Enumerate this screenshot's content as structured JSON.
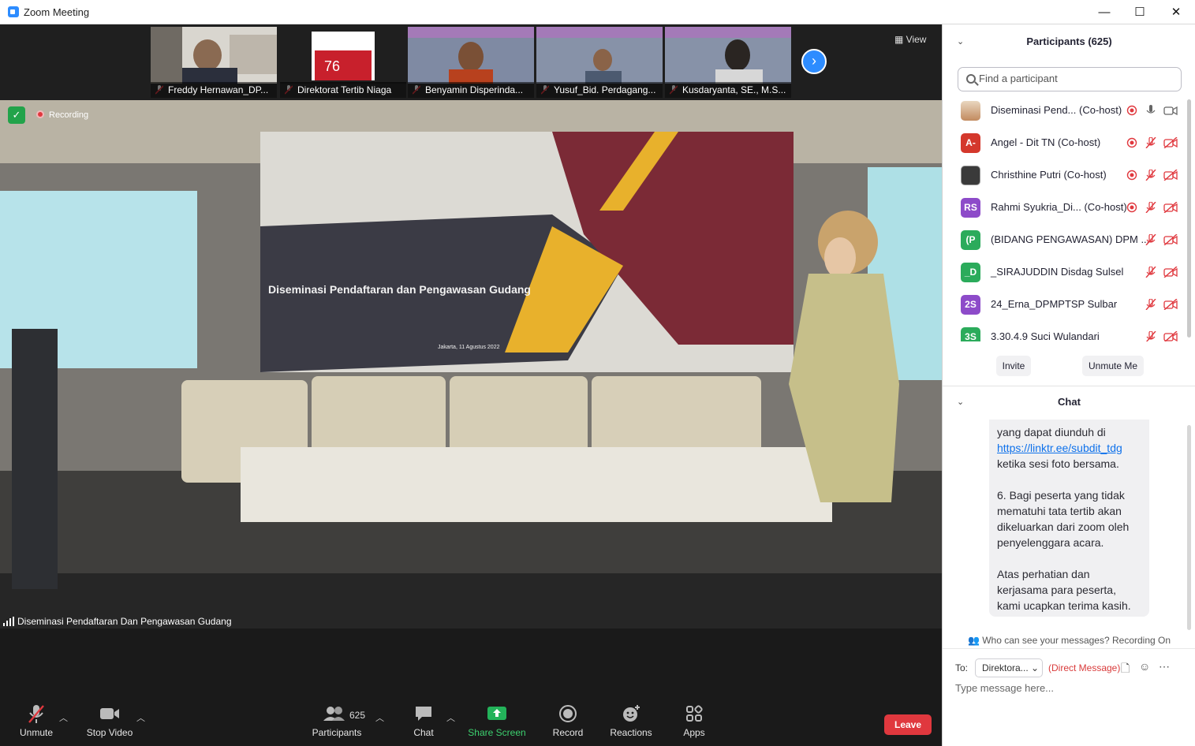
{
  "window": {
    "title": "Zoom Meeting",
    "minimize": "—",
    "maximize": "☐",
    "close": "✕"
  },
  "thumbnails": [
    {
      "name": "Freddy Hernawan_DP..."
    },
    {
      "name": "Direktorat Tertib Niaga"
    },
    {
      "name": "Benyamin Disperinda..."
    },
    {
      "name": "Yusuf_Bid. Perdagang..."
    },
    {
      "name": "Kusdaryanta, SE., M.S..."
    }
  ],
  "view_label": "View",
  "recording_label": "Recording",
  "active_speaker": "Diseminasi Pendaftaran Dan Pengawasan Gudang",
  "toolbar": {
    "unmute": "Unmute",
    "stop_video": "Stop Video",
    "participants": "Participants",
    "participants_count": "625",
    "chat": "Chat",
    "share_screen": "Share Screen",
    "record": "Record",
    "reactions": "Reactions",
    "apps": "Apps",
    "leave": "Leave"
  },
  "participants_panel": {
    "title": "Participants (625)",
    "search_placeholder": "Find a participant",
    "participants": [
      {
        "name": "Diseminasi Pend... (Co-host)",
        "initials": "",
        "color": "#b8926a",
        "mic": "on",
        "video": "on"
      },
      {
        "name": "Angel - Dit TN (Co-host)",
        "initials": "A-",
        "color": "#d4382c",
        "mic": "muted",
        "video": "off"
      },
      {
        "name": "Christhine Putri (Co-host)",
        "initials": "",
        "color": "#3a3a3a",
        "mic": "muted",
        "video": "off"
      },
      {
        "name": "Rahmi Syukria_Di... (Co-host)",
        "initials": "RS",
        "color": "#8d4bc9",
        "mic": "muted",
        "video": "off"
      },
      {
        "name": "(BIDANG PENGAWASAN) DPM ...",
        "initials": "(P",
        "color": "#2bab5b",
        "mic": "muted",
        "video": "off"
      },
      {
        "name": "_SIRAJUDDIN Disdag Sulsel",
        "initials": "_D",
        "color": "#2bab5b",
        "mic": "muted",
        "video": "off"
      },
      {
        "name": "24_Erna_DPMPTSP Sulbar",
        "initials": "2S",
        "color": "#8d4bc9",
        "mic": "muted",
        "video": "off"
      },
      {
        "name": "3.30.4.9 Suci Wulandari",
        "initials": "3S",
        "color": "#2bab5b",
        "mic": "muted",
        "video": "off"
      }
    ],
    "invite": "Invite",
    "unmute_me": "Unmute Me"
  },
  "chat_panel": {
    "title": "Chat",
    "message_lines": [
      "yang dapat diunduh di",
      "ketika sesi foto bersama.",
      "",
      "6. Bagi peserta yang tidak",
      "mematuhi tata tertib akan",
      "dikeluarkan dari zoom oleh",
      "penyelenggara acara.",
      "",
      "Atas perhatian dan",
      "kerjasama para peserta,",
      "kami ucapkan terima kasih."
    ],
    "link": "https://linktr.ee/subdit_tdg",
    "visibility_note": "Who can see your messages? Recording On",
    "to_label": "To:",
    "recipient": "Direktora...",
    "direct_message": "(Direct Message)",
    "input_placeholder": "Type message here..."
  },
  "banner": {
    "title": "Diseminasi Pendaftaran dan Pengawasan Gudang",
    "date": "Jakarta, 11 Agustus 2022"
  }
}
